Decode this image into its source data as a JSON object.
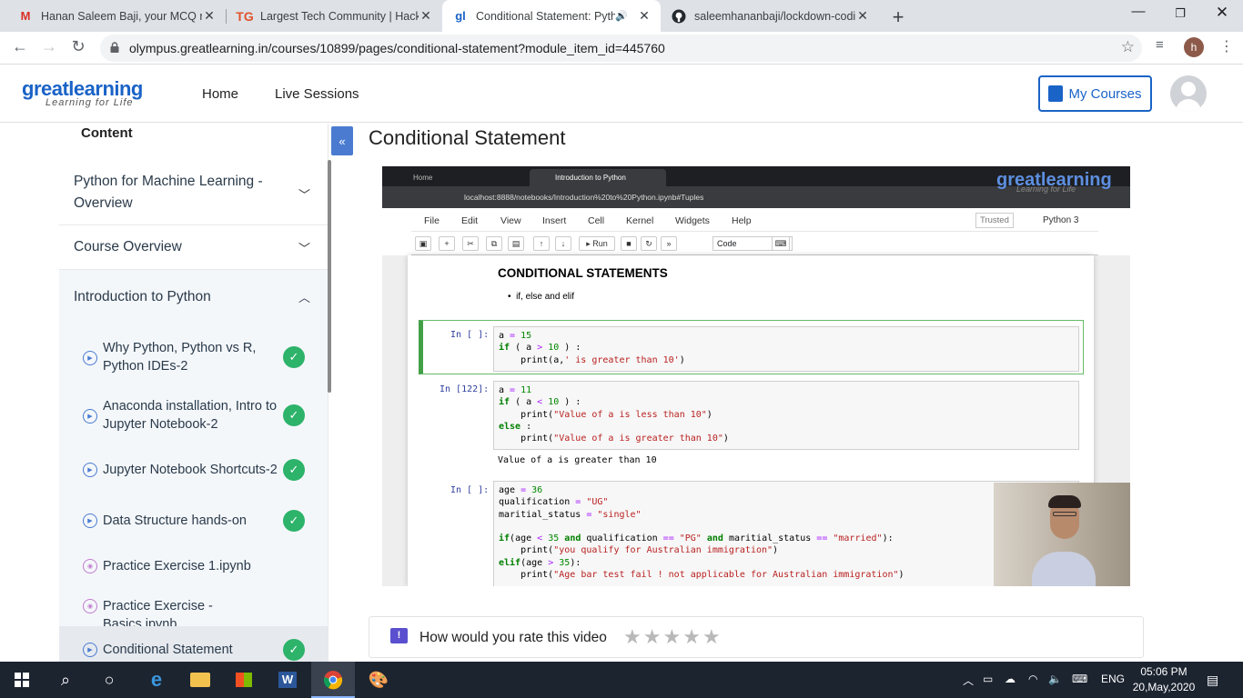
{
  "browser": {
    "tabs": [
      {
        "title": "Hanan Saleem Baji, your MCQ re",
        "icon": "gmail-icon"
      },
      {
        "title": "Largest Tech Community | Hacka",
        "icon": "techgig-icon"
      },
      {
        "title": "Conditional Statement: Pytho",
        "icon": "greatlearning-icon",
        "active": true
      },
      {
        "title": "saleemhananbaji/lockdown-codi",
        "icon": "github-icon"
      }
    ],
    "url": "olympus.greatlearning.in/courses/10899/pages/conditional-statement?module_item_id=445760",
    "profile_initial": "h"
  },
  "header": {
    "logo_main": "greatlearning",
    "logo_sub": "Learning for Life",
    "nav": [
      "Home",
      "Live Sessions"
    ],
    "my_courses": "My Courses"
  },
  "sidebar": {
    "title": "Content",
    "sections": [
      "Python for Machine Learning - Overview",
      "Course Overview",
      "Introduction to Python"
    ],
    "items": [
      {
        "label": "Why Python, Python vs R, Python IDEs-2",
        "type": "video",
        "done": true
      },
      {
        "label": "Anaconda installation, Intro to Jupyter Notebook-2",
        "type": "video",
        "done": true
      },
      {
        "label": "Jupyter Notebook Shortcuts-2",
        "type": "video",
        "done": true
      },
      {
        "label": "Data Structure hands-on",
        "type": "video",
        "done": true
      },
      {
        "label": "Practice Exercise 1.ipynb",
        "type": "notebook",
        "done": false
      },
      {
        "label": "Practice Exercise - Basics.ipynb",
        "type": "notebook",
        "done": false
      },
      {
        "label": "Conditional Statement",
        "type": "video",
        "done": true,
        "selected": true
      }
    ]
  },
  "main": {
    "title": "Conditional Statement",
    "video": {
      "tabs": [
        "Home",
        "Introduction to Python"
      ],
      "url": "localhost:8888/notebooks/Introduction%20to%20Python.ipynb#Tuples",
      "logo": "greatlearning",
      "logo_sub": "Learning for Life",
      "menu": [
        "File",
        "Edit",
        "View",
        "Insert",
        "Cell",
        "Kernel",
        "Widgets",
        "Help"
      ],
      "trusted": "Trusted",
      "kernel": "Python 3",
      "run_label": "Run",
      "cell_type": "Code",
      "md_heading": "CONDITIONAL STATEMENTS",
      "md_bullet": "if, else and elif",
      "prompts": [
        "In [ ]:",
        "In [122]:",
        "In [ ]:"
      ],
      "output": "Value of a is greater than 10"
    },
    "rating_question": "How would you rate this video",
    "rating_value": 0,
    "rating_max": 5
  },
  "taskbar": {
    "lang": "ENG",
    "time": "05:06 PM",
    "date": "20,May,2020"
  }
}
